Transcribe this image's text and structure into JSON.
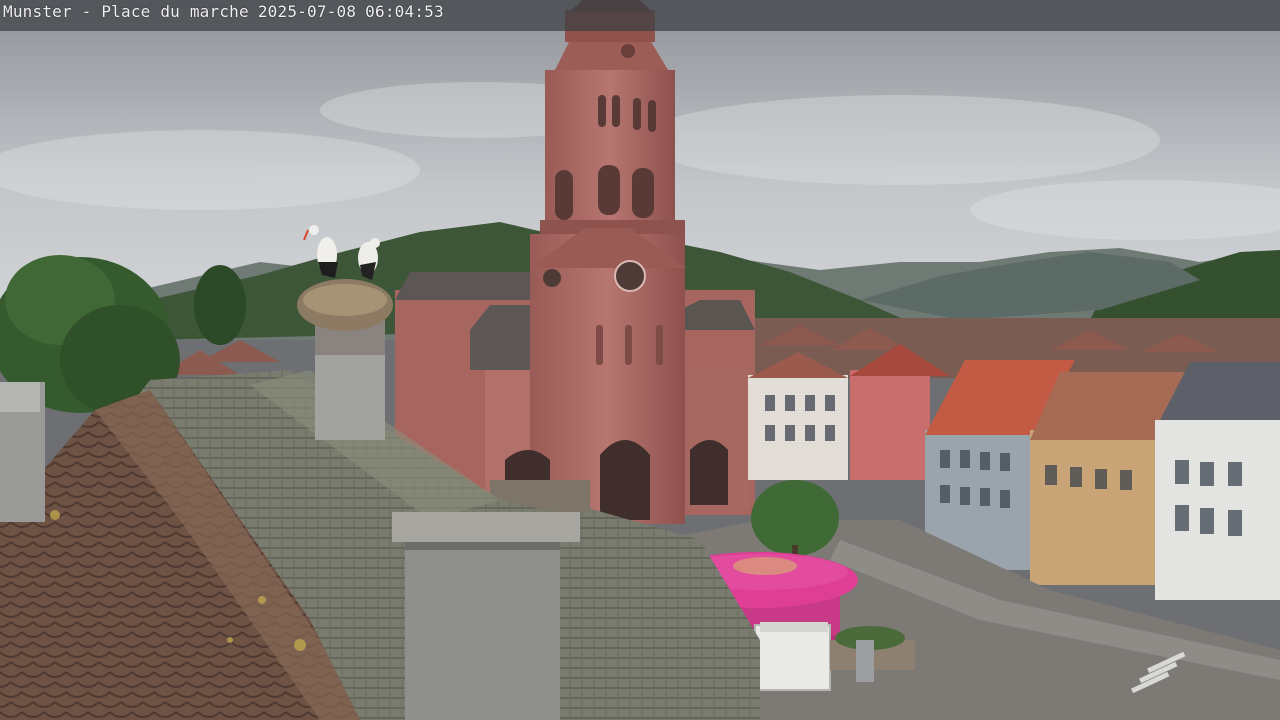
{
  "overlay": {
    "location": "Munster - Place du marche",
    "date": "2025-07-08",
    "time": "06:04:53"
  },
  "colors": {
    "sky": "#b9bdc2",
    "sandstone": "#b8736b",
    "roof_tiles": "#7a5a4d",
    "mossy_roof": "#8f927f",
    "hills": "#3e5a3a",
    "pavilion": "#d9378f"
  }
}
